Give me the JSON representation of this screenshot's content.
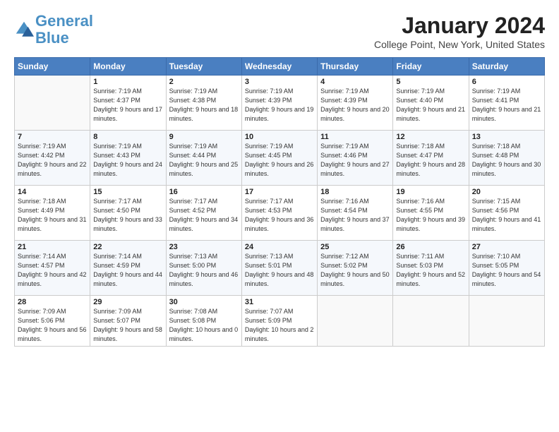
{
  "header": {
    "logo_general": "General",
    "logo_blue": "Blue",
    "title": "January 2024",
    "subtitle": "College Point, New York, United States"
  },
  "weekdays": [
    "Sunday",
    "Monday",
    "Tuesday",
    "Wednesday",
    "Thursday",
    "Friday",
    "Saturday"
  ],
  "weeks": [
    [
      {
        "day": "",
        "sunrise": "",
        "sunset": "",
        "daylight": ""
      },
      {
        "day": "1",
        "sunrise": "Sunrise: 7:19 AM",
        "sunset": "Sunset: 4:37 PM",
        "daylight": "Daylight: 9 hours and 17 minutes."
      },
      {
        "day": "2",
        "sunrise": "Sunrise: 7:19 AM",
        "sunset": "Sunset: 4:38 PM",
        "daylight": "Daylight: 9 hours and 18 minutes."
      },
      {
        "day": "3",
        "sunrise": "Sunrise: 7:19 AM",
        "sunset": "Sunset: 4:39 PM",
        "daylight": "Daylight: 9 hours and 19 minutes."
      },
      {
        "day": "4",
        "sunrise": "Sunrise: 7:19 AM",
        "sunset": "Sunset: 4:39 PM",
        "daylight": "Daylight: 9 hours and 20 minutes."
      },
      {
        "day": "5",
        "sunrise": "Sunrise: 7:19 AM",
        "sunset": "Sunset: 4:40 PM",
        "daylight": "Daylight: 9 hours and 21 minutes."
      },
      {
        "day": "6",
        "sunrise": "Sunrise: 7:19 AM",
        "sunset": "Sunset: 4:41 PM",
        "daylight": "Daylight: 9 hours and 21 minutes."
      }
    ],
    [
      {
        "day": "7",
        "sunrise": "Sunrise: 7:19 AM",
        "sunset": "Sunset: 4:42 PM",
        "daylight": "Daylight: 9 hours and 22 minutes."
      },
      {
        "day": "8",
        "sunrise": "Sunrise: 7:19 AM",
        "sunset": "Sunset: 4:43 PM",
        "daylight": "Daylight: 9 hours and 24 minutes."
      },
      {
        "day": "9",
        "sunrise": "Sunrise: 7:19 AM",
        "sunset": "Sunset: 4:44 PM",
        "daylight": "Daylight: 9 hours and 25 minutes."
      },
      {
        "day": "10",
        "sunrise": "Sunrise: 7:19 AM",
        "sunset": "Sunset: 4:45 PM",
        "daylight": "Daylight: 9 hours and 26 minutes."
      },
      {
        "day": "11",
        "sunrise": "Sunrise: 7:19 AM",
        "sunset": "Sunset: 4:46 PM",
        "daylight": "Daylight: 9 hours and 27 minutes."
      },
      {
        "day": "12",
        "sunrise": "Sunrise: 7:18 AM",
        "sunset": "Sunset: 4:47 PM",
        "daylight": "Daylight: 9 hours and 28 minutes."
      },
      {
        "day": "13",
        "sunrise": "Sunrise: 7:18 AM",
        "sunset": "Sunset: 4:48 PM",
        "daylight": "Daylight: 9 hours and 30 minutes."
      }
    ],
    [
      {
        "day": "14",
        "sunrise": "Sunrise: 7:18 AM",
        "sunset": "Sunset: 4:49 PM",
        "daylight": "Daylight: 9 hours and 31 minutes."
      },
      {
        "day": "15",
        "sunrise": "Sunrise: 7:17 AM",
        "sunset": "Sunset: 4:50 PM",
        "daylight": "Daylight: 9 hours and 33 minutes."
      },
      {
        "day": "16",
        "sunrise": "Sunrise: 7:17 AM",
        "sunset": "Sunset: 4:52 PM",
        "daylight": "Daylight: 9 hours and 34 minutes."
      },
      {
        "day": "17",
        "sunrise": "Sunrise: 7:17 AM",
        "sunset": "Sunset: 4:53 PM",
        "daylight": "Daylight: 9 hours and 36 minutes."
      },
      {
        "day": "18",
        "sunrise": "Sunrise: 7:16 AM",
        "sunset": "Sunset: 4:54 PM",
        "daylight": "Daylight: 9 hours and 37 minutes."
      },
      {
        "day": "19",
        "sunrise": "Sunrise: 7:16 AM",
        "sunset": "Sunset: 4:55 PM",
        "daylight": "Daylight: 9 hours and 39 minutes."
      },
      {
        "day": "20",
        "sunrise": "Sunrise: 7:15 AM",
        "sunset": "Sunset: 4:56 PM",
        "daylight": "Daylight: 9 hours and 41 minutes."
      }
    ],
    [
      {
        "day": "21",
        "sunrise": "Sunrise: 7:14 AM",
        "sunset": "Sunset: 4:57 PM",
        "daylight": "Daylight: 9 hours and 42 minutes."
      },
      {
        "day": "22",
        "sunrise": "Sunrise: 7:14 AM",
        "sunset": "Sunset: 4:59 PM",
        "daylight": "Daylight: 9 hours and 44 minutes."
      },
      {
        "day": "23",
        "sunrise": "Sunrise: 7:13 AM",
        "sunset": "Sunset: 5:00 PM",
        "daylight": "Daylight: 9 hours and 46 minutes."
      },
      {
        "day": "24",
        "sunrise": "Sunrise: 7:13 AM",
        "sunset": "Sunset: 5:01 PM",
        "daylight": "Daylight: 9 hours and 48 minutes."
      },
      {
        "day": "25",
        "sunrise": "Sunrise: 7:12 AM",
        "sunset": "Sunset: 5:02 PM",
        "daylight": "Daylight: 9 hours and 50 minutes."
      },
      {
        "day": "26",
        "sunrise": "Sunrise: 7:11 AM",
        "sunset": "Sunset: 5:03 PM",
        "daylight": "Daylight: 9 hours and 52 minutes."
      },
      {
        "day": "27",
        "sunrise": "Sunrise: 7:10 AM",
        "sunset": "Sunset: 5:05 PM",
        "daylight": "Daylight: 9 hours and 54 minutes."
      }
    ],
    [
      {
        "day": "28",
        "sunrise": "Sunrise: 7:09 AM",
        "sunset": "Sunset: 5:06 PM",
        "daylight": "Daylight: 9 hours and 56 minutes."
      },
      {
        "day": "29",
        "sunrise": "Sunrise: 7:09 AM",
        "sunset": "Sunset: 5:07 PM",
        "daylight": "Daylight: 9 hours and 58 minutes."
      },
      {
        "day": "30",
        "sunrise": "Sunrise: 7:08 AM",
        "sunset": "Sunset: 5:08 PM",
        "daylight": "Daylight: 10 hours and 0 minutes."
      },
      {
        "day": "31",
        "sunrise": "Sunrise: 7:07 AM",
        "sunset": "Sunset: 5:09 PM",
        "daylight": "Daylight: 10 hours and 2 minutes."
      },
      {
        "day": "",
        "sunrise": "",
        "sunset": "",
        "daylight": ""
      },
      {
        "day": "",
        "sunrise": "",
        "sunset": "",
        "daylight": ""
      },
      {
        "day": "",
        "sunrise": "",
        "sunset": "",
        "daylight": ""
      }
    ]
  ]
}
